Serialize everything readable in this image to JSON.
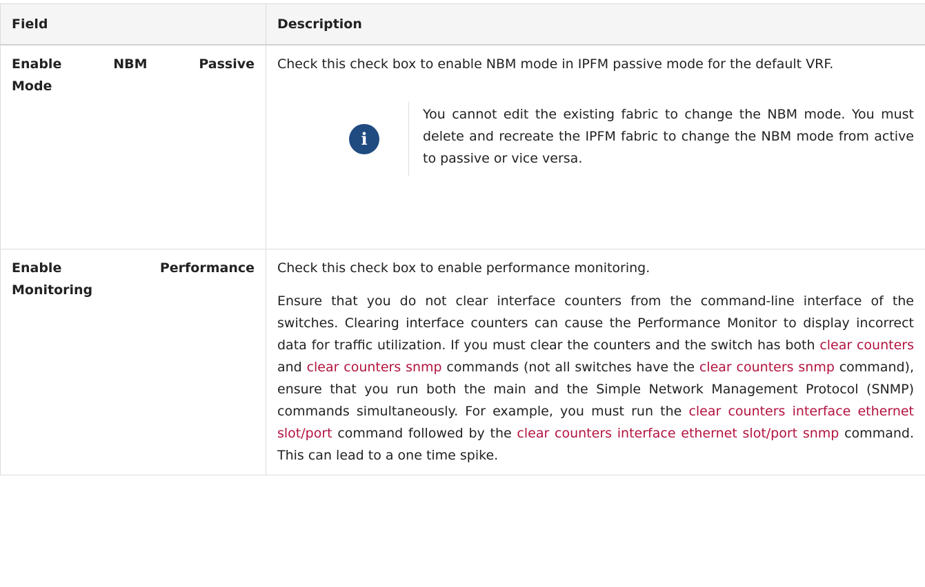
{
  "table": {
    "headers": [
      "Field",
      "Description"
    ],
    "rows": [
      {
        "field_line1": "Enable NBM Passive",
        "field_line2": "Mode",
        "description": "Check this check box to enable NBM mode in IPFM passive mode for the default VRF.",
        "note": "You cannot edit the existing fabric to change the NBM mode. You must delete and recreate the IPFM fabric to change the NBM mode from active to passive or vice versa.",
        "note_icon": "info-icon"
      },
      {
        "field_line1": "Enable Performance",
        "field_line2": "Monitoring",
        "description": "Check this check box to enable performance monitoring.",
        "detail": {
          "t1": "Ensure that you do not clear interface counters from the command-line interface of the switches. Clearing interface counters can cause the Performance Monitor to display incorrect data for traffic utilization. If you must clear the counters and the switch has both ",
          "c1": "clear counters",
          "t2": " and ",
          "c2": "clear counters snmp",
          "t3": " commands (not all switches have the ",
          "c3": "clear counters snmp",
          "t4": " command), ensure that you run both the main and the Simple Network Management Protocol (SNMP) commands simultaneously. For example, you must run the ",
          "c4": "clear counters interface ethernet slot/port",
          "t5": " command followed by the ",
          "c5": "clear counters interface ethernet slot/port snmp",
          "t6": " command. This can lead to a one time spike."
        }
      }
    ]
  },
  "colors": {
    "command": "#b3123f",
    "info_icon_bg": "#1f4b80",
    "header_bg": "#f5f5f5"
  }
}
